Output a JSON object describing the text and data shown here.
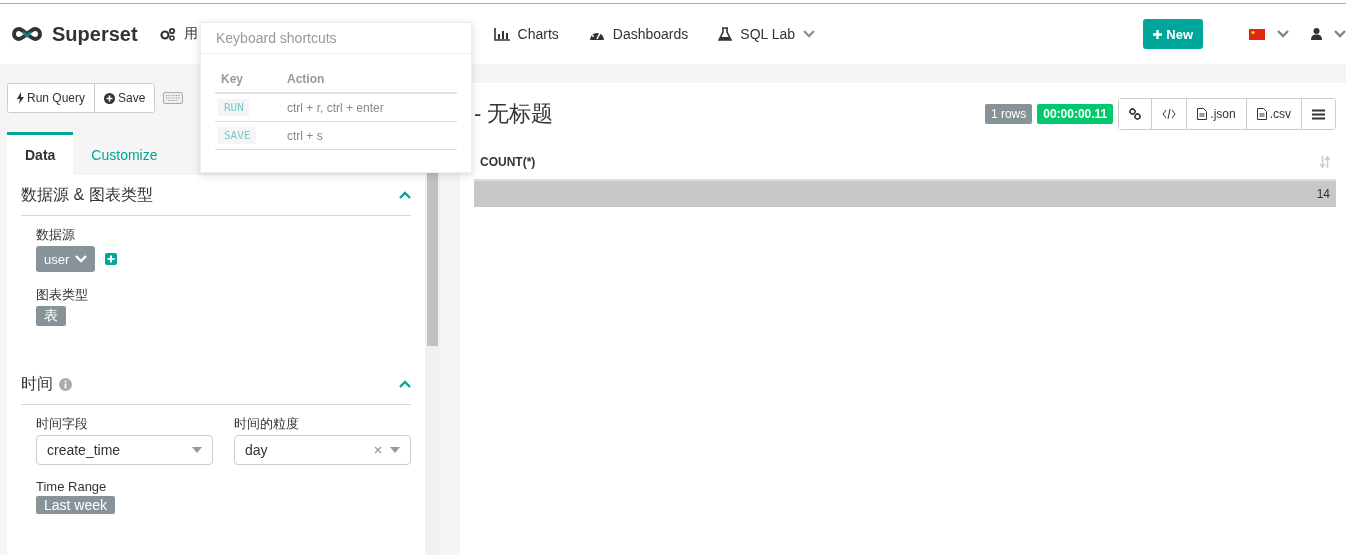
{
  "brand": "Superset",
  "nav": [
    {
      "label": "用",
      "dropdown": false
    },
    {
      "label": "Charts",
      "dropdown": false
    },
    {
      "label": "Dashboards",
      "dropdown": false
    },
    {
      "label": "SQL Lab",
      "dropdown": true
    }
  ],
  "new_button": "New",
  "toolbar": [
    "Run Query",
    "Save"
  ],
  "tabs": [
    {
      "label": "Data",
      "selected": true
    },
    {
      "label": "Customize",
      "selected": false
    }
  ],
  "sections": [
    {
      "title": "数据源 & 图表类型",
      "info": false,
      "expanded": true,
      "controls": [
        {
          "kind": "datasource",
          "label": "数据源",
          "value": "user"
        },
        {
          "kind": "tag",
          "label": "图表类型",
          "value": "表"
        }
      ]
    },
    {
      "title": "时间",
      "info": true,
      "expanded": true,
      "controls": [
        {
          "kind": "select",
          "label": "时间字段",
          "value": "create_time",
          "clearable": false
        },
        {
          "kind": "select",
          "label": "时间的粒度",
          "value": "day",
          "clearable": true
        },
        {
          "kind": "tag",
          "label": "Time Range",
          "value": "Last week"
        }
      ]
    }
  ],
  "result": {
    "title": "- 无标题",
    "row_count": "1 rows",
    "duration": "00:00:00.11",
    "exports": [
      ".json",
      ".csv"
    ],
    "columns": [
      "COUNT(*)"
    ],
    "rows": [
      [
        "14"
      ]
    ]
  },
  "shortcuts_popover": {
    "title": "Keyboard shortcuts",
    "headers": [
      "Key",
      "Action"
    ],
    "rows": [
      {
        "key": "RUN",
        "action": "ctrl + r, ctrl + enter"
      },
      {
        "key": "SAVE",
        "action": "ctrl + s"
      }
    ]
  }
}
